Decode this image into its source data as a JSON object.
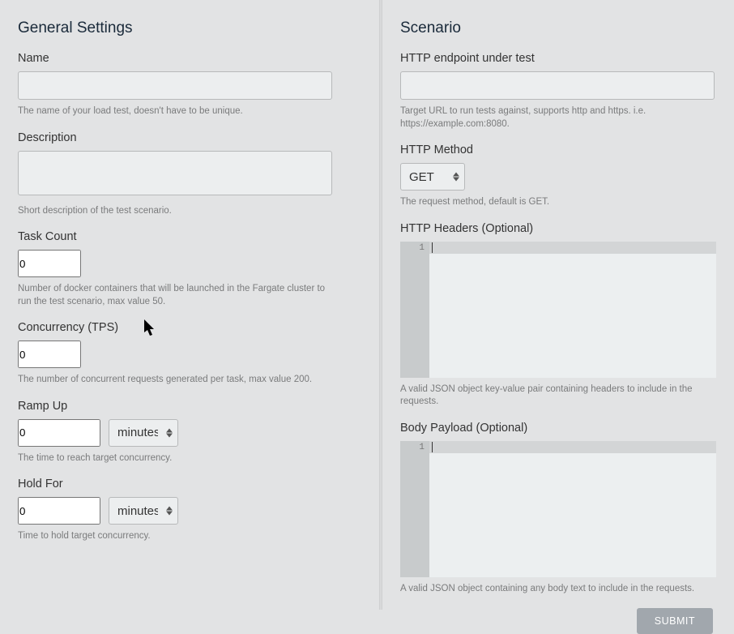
{
  "general": {
    "title": "General Settings",
    "name": {
      "label": "Name",
      "value": "",
      "help": "The name of your load test, doesn't have to be unique."
    },
    "description": {
      "label": "Description",
      "value": "",
      "help": "Short description of the test scenario."
    },
    "taskCount": {
      "label": "Task Count",
      "value": "0",
      "help": "Number of docker containers that will be launched in the Fargate cluster to run the test scenario, max value 50."
    },
    "concurrency": {
      "label": "Concurrency (TPS)",
      "value": "0",
      "help": "The number of concurrent requests generated per task, max value 200."
    },
    "rampUp": {
      "label": "Ramp Up",
      "value": "0",
      "unit": "minutes",
      "help": "The time to reach target concurrency."
    },
    "holdFor": {
      "label": "Hold For",
      "value": "0",
      "unit": "minutes",
      "help": "Time to hold target concurrency."
    }
  },
  "scenario": {
    "title": "Scenario",
    "endpoint": {
      "label": "HTTP endpoint under test",
      "value": "",
      "help": "Target URL to run tests against, supports http and https. i.e. https://example.com:8080."
    },
    "method": {
      "label": "HTTP Method",
      "value": "GET",
      "help": "The request method, default is GET."
    },
    "headers": {
      "label": "HTTP Headers (Optional)",
      "lineNumber": "1",
      "help": "A valid JSON object key-value pair containing headers to include in the requests."
    },
    "body": {
      "label": "Body Payload (Optional)",
      "lineNumber": "1",
      "help": "A valid JSON object containing any body text to include in the requests."
    },
    "submitLabel": "SUBMIT"
  }
}
